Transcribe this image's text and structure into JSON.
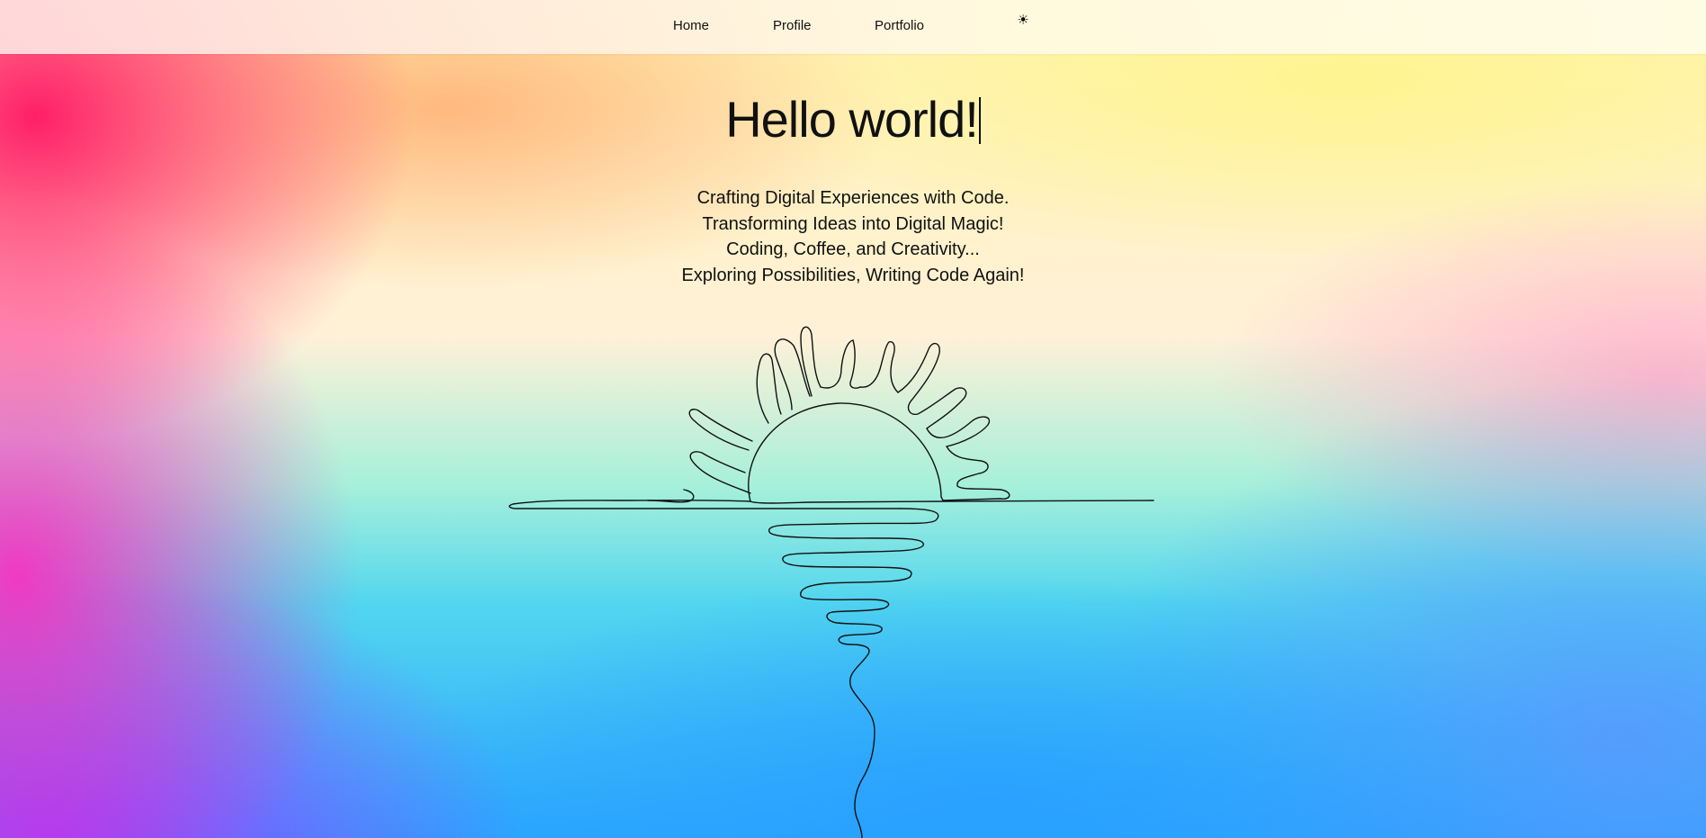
{
  "nav": {
    "home": "Home",
    "profile": "Profile",
    "portfolio": "Portfolio",
    "theme_toggle_icon": "sun-icon",
    "theme_toggle_glyph": "☀"
  },
  "hero": {
    "title": "Hello world!",
    "taglines": [
      "Crafting Digital Experiences with Code.",
      "Transforming Ideas into Digital Magic!",
      "Coding, Coffee, and Creativity...",
      "Exploring Possibilities, Writing Code Again!"
    ]
  },
  "colors": {
    "text": "#111111",
    "line_art": "#111111",
    "gradient_pink": "#ff1464",
    "gradient_yellow": "#fff48c",
    "gradient_teal": "#a6f0da",
    "gradient_blue": "#2aa6ff",
    "gradient_purple": "#a03cff"
  }
}
